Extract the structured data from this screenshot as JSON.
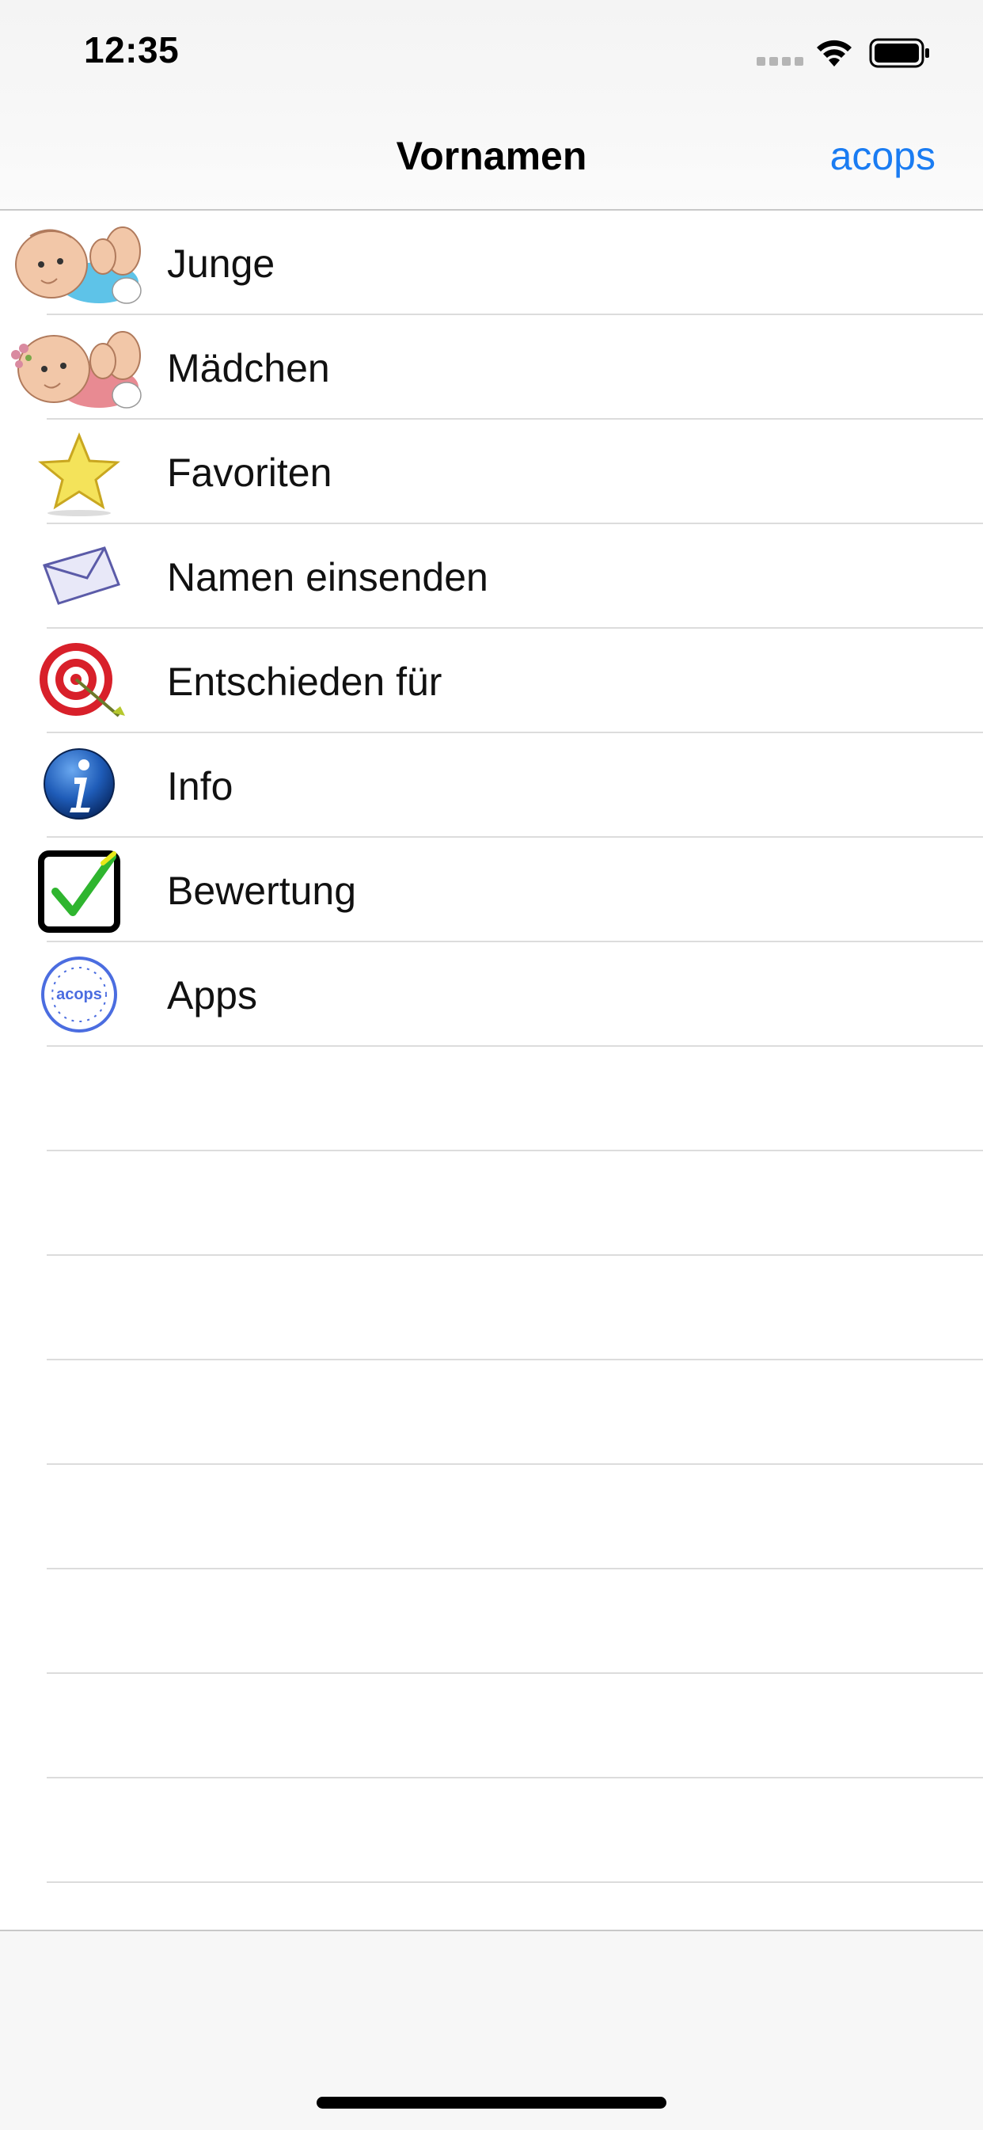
{
  "status_bar": {
    "time": "12:35"
  },
  "nav": {
    "title": "Vornamen",
    "right_button": "acops"
  },
  "menu": [
    {
      "label": "Junge",
      "icon": "baby-boy-icon"
    },
    {
      "label": "Mädchen",
      "icon": "baby-girl-icon"
    },
    {
      "label": "Favoriten",
      "icon": "star-icon"
    },
    {
      "label": "Namen einsenden",
      "icon": "envelope-icon"
    },
    {
      "label": "Entschieden für",
      "icon": "target-icon"
    },
    {
      "label": "Info",
      "icon": "info-icon"
    },
    {
      "label": "Bewertung",
      "icon": "checkbox-icon"
    },
    {
      "label": "Apps",
      "icon": "acops-stamp-icon"
    }
  ],
  "icon_stamp_text": "acops",
  "colors": {
    "accent": "#1a7cf2",
    "separator": "#dcdcdc"
  }
}
